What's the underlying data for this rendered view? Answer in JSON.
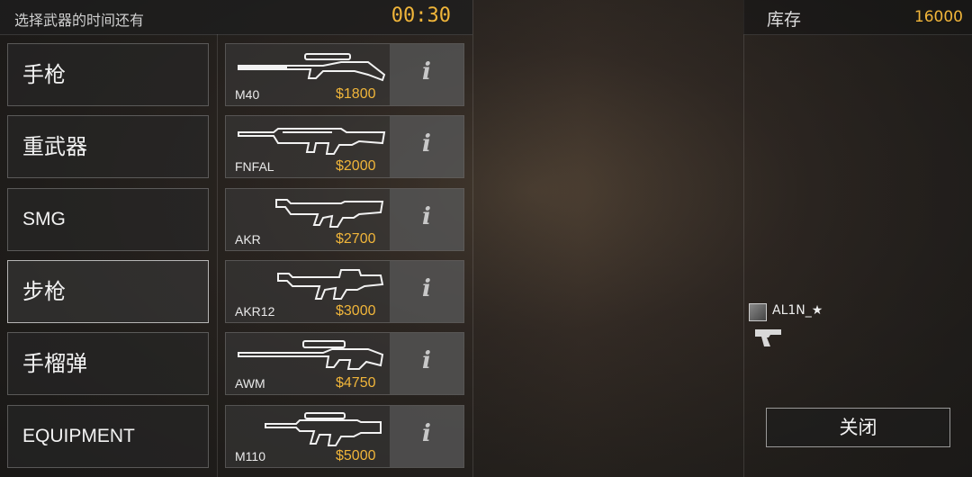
{
  "timer": {
    "label": "选择武器的时间还有",
    "value": "00:30"
  },
  "inventory": {
    "label": "库存",
    "value": "16000"
  },
  "categories": [
    {
      "label": "手枪",
      "selected": false
    },
    {
      "label": "重武器",
      "selected": false
    },
    {
      "label": "SMG",
      "selected": false
    },
    {
      "label": "步枪",
      "selected": true
    },
    {
      "label": "手榴弹",
      "selected": false
    },
    {
      "label": "EQUIPMENT",
      "selected": false
    }
  ],
  "weapons": [
    {
      "name": "M40",
      "price": "$1800",
      "icon": "sniper-rifle-icon"
    },
    {
      "name": "FNFAL",
      "price": "$2000",
      "icon": "battle-rifle-icon"
    },
    {
      "name": "AKR",
      "price": "$2700",
      "icon": "assault-rifle-icon"
    },
    {
      "name": "AKR12",
      "price": "$3000",
      "icon": "assault-rifle-icon"
    },
    {
      "name": "AWM",
      "price": "$4750",
      "icon": "sniper-rifle-icon"
    },
    {
      "name": "M110",
      "price": "$5000",
      "icon": "marksman-rifle-icon"
    }
  ],
  "info_label": "i",
  "player": {
    "name": "AL1N_★",
    "weapon_icon": "pistol-icon"
  },
  "close_button": "关闭",
  "colors": {
    "accent": "#f0b53a",
    "text": "#e8e8e8"
  }
}
